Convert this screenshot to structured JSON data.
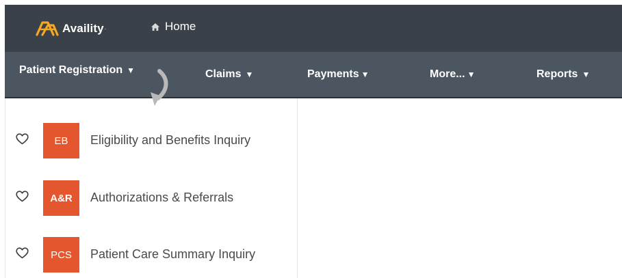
{
  "header": {
    "brand_name": "Availity",
    "brand_trademark": "·",
    "home_label": "Home"
  },
  "nav": {
    "items": [
      {
        "label": "Patient Registration",
        "caret": "▼"
      },
      {
        "label": "Claims",
        "caret": "▼"
      },
      {
        "label": "Payments",
        "caret": "▼"
      },
      {
        "label": "More...",
        "caret": "▼"
      },
      {
        "label": "Reports",
        "caret": "▼"
      }
    ]
  },
  "dropdown": {
    "items": [
      {
        "badge": "EB",
        "label": "Eligibility and Benefits Inquiry"
      },
      {
        "badge": "A&R",
        "label": "Authorizations & Referrals"
      },
      {
        "badge": "PCS",
        "label": "Patient Care Summary Inquiry"
      }
    ]
  },
  "colors": {
    "topbar": "#3a4148",
    "navbar": "#4b5661",
    "badge": "#e4572e",
    "logo_orange": "#f7a823"
  },
  "icons": {
    "logo": "availity-logo-icon",
    "home": "home-icon",
    "favorite": "heart-outline-icon",
    "pointer": "curved-arrow-icon"
  }
}
